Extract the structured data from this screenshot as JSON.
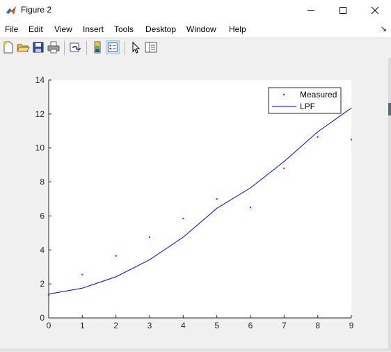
{
  "window": {
    "title": "Figure 2"
  },
  "menu": [
    "File",
    "Edit",
    "View",
    "Insert",
    "Tools",
    "Desktop",
    "Window",
    "Help"
  ],
  "toolbar": {
    "icons": [
      "new-figure-icon",
      "open-file-icon",
      "save-icon",
      "print-icon",
      "link-plot-icon",
      "insert-colorbar-icon",
      "insert-legend-icon",
      "edit-plot-icon",
      "property-inspector-icon"
    ]
  },
  "chart_data": {
    "type": "line",
    "title": "",
    "xlabel": "",
    "ylabel": "",
    "xlim": [
      0,
      9
    ],
    "ylim": [
      0,
      14
    ],
    "x_ticks": [
      "0",
      "1",
      "2",
      "3",
      "4",
      "5",
      "6",
      "7",
      "8",
      "9"
    ],
    "y_ticks": [
      "0",
      "2",
      "4",
      "6",
      "8",
      "10",
      "12",
      "14"
    ],
    "grid": false,
    "legend_position": "top-right",
    "series": [
      {
        "name": "Measured",
        "style": "points",
        "color": "#ff0000",
        "x": [
          0,
          1,
          2,
          3,
          4,
          5,
          6,
          7,
          8,
          9
        ],
        "y": [
          1.35,
          2.55,
          3.65,
          4.75,
          5.85,
          7.0,
          6.5,
          8.8,
          10.65,
          10.5
        ]
      },
      {
        "name": "LPF",
        "style": "line",
        "color": "#0000ff",
        "x": [
          0,
          1,
          2,
          3,
          4,
          5,
          6,
          7,
          8,
          9
        ],
        "y": [
          1.4,
          1.75,
          2.42,
          3.42,
          4.75,
          6.45,
          7.65,
          9.2,
          10.95,
          12.35
        ]
      }
    ]
  }
}
